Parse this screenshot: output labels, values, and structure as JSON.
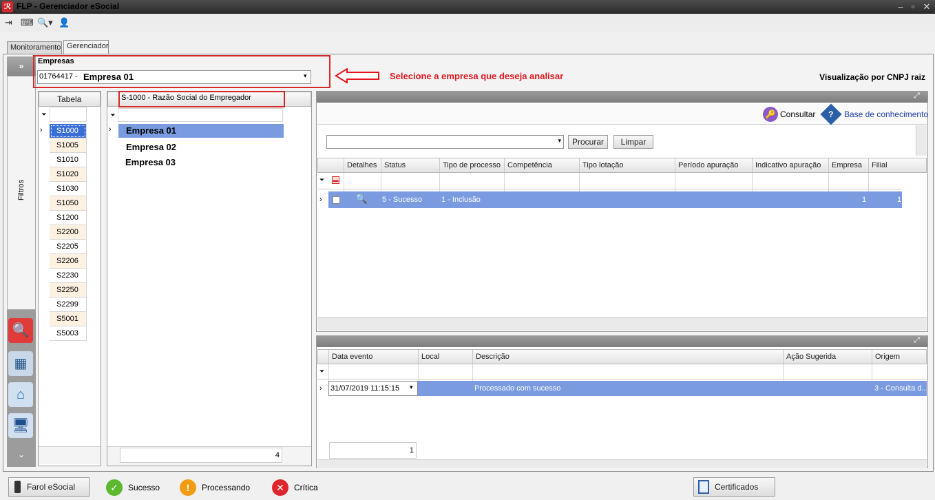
{
  "window": {
    "title": "FLP - Gerenciador eSocial",
    "app_icon": "flp-logo-icon",
    "controls": [
      "minimize-icon",
      "restore-icon",
      "close-icon"
    ]
  },
  "toolbar": {
    "icons": [
      "exit-icon",
      "keyboard-icon",
      "search-dropdown-icon",
      "user-icon"
    ]
  },
  "tabs": [
    {
      "label": "Monitoramento"
    },
    {
      "label": "Gerenciador"
    }
  ],
  "sidebar": {
    "toggle": "»",
    "filters_label": "Filtros"
  },
  "empresas": {
    "label": "Empresas",
    "selected_code": "01764417 -",
    "selected_name": "Empresa 01",
    "annotation": "Selecione a empresa que deseja analisar",
    "annotation_color": "#e8141c"
  },
  "view_mode": "Visualização por CNPJ raiz",
  "tabela_grid": {
    "header": "Tabela",
    "rows": [
      "S1000",
      "S1005",
      "S1010",
      "S1020",
      "S1030",
      "S1050",
      "S1200",
      "S2200",
      "S2205",
      "S2206",
      "S2230",
      "S2250",
      "S2299",
      "S5001",
      "S5003"
    ],
    "selected": "S1000"
  },
  "razao_grid": {
    "header": "S-1000 - Razão Social do Empregador",
    "rows": [
      "Empresa 01",
      "Empresa 02",
      "Empresa 03"
    ],
    "footer_count": "4"
  },
  "right_panel": {
    "consultar_label": "Consultar",
    "base_label": "Base de conhecimento",
    "procurar_label": "Procurar",
    "limpar_label": "Limpar",
    "columns": [
      "Detalhes",
      "Status",
      "Tipo de processo",
      "Competência",
      "Tipo lotação",
      "Período apuração",
      "Indicativo apuração",
      "Empresa",
      "Filial"
    ],
    "row": {
      "status": "5 - Sucesso",
      "tipo": "1 - Inclusão",
      "empresa": "1",
      "filial": "1"
    }
  },
  "events_grid": {
    "columns": [
      "Data evento",
      "Local",
      "Descrição",
      "Ação Sugerida",
      "Origem"
    ],
    "row": {
      "data": "31/07/2019 11:15:15",
      "descricao": "Processado com sucesso",
      "origem": "3 - Consulta d..."
    },
    "footer_count": "1"
  },
  "status_bar": {
    "farol_label": "Farol eSocial",
    "sucesso_label": "Sucesso",
    "processando_label": "Processando",
    "critica_label": "Crítica",
    "certificados_label": "Certificados",
    "colors": {
      "sucesso": "#5cb82e",
      "processando": "#f39c12",
      "critica": "#e0262d",
      "selection": "#7a9be0"
    }
  }
}
